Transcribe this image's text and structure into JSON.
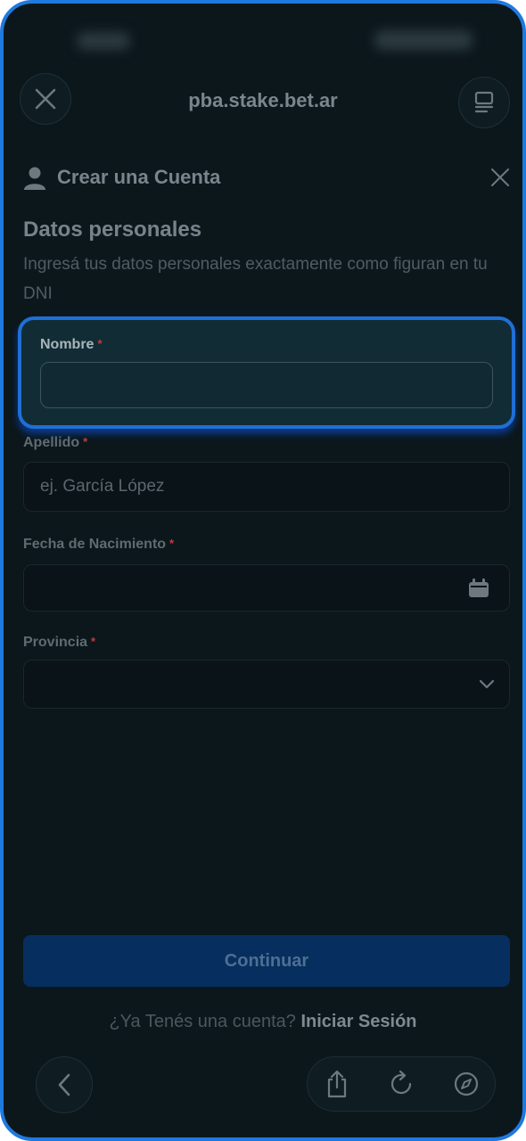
{
  "browser": {
    "url": "pba.stake.bet.ar",
    "close_icon": "close-icon",
    "tabs_icon": "tabs-icon",
    "back_icon": "chevron-left-icon",
    "share_icon": "share-icon",
    "reload_icon": "reload-icon",
    "compass_icon": "compass-icon"
  },
  "modal": {
    "title": "Crear una Cuenta",
    "user_icon": "user-icon",
    "close_icon": "close-icon"
  },
  "section": {
    "title": "Datos personales",
    "description": "Ingresá tus datos personales exactamente como figuran en tu DNI"
  },
  "form": {
    "nombre": {
      "label": "Nombre",
      "required_mark": "*",
      "value": "",
      "placeholder": ""
    },
    "apellido": {
      "label": "Apellido",
      "required_mark": "*",
      "value": "",
      "placeholder": "ej. García López"
    },
    "fecha": {
      "label": "Fecha de Nacimiento",
      "required_mark": "*",
      "value": "",
      "icon": "calendar-icon"
    },
    "provincia": {
      "label": "Provincia",
      "required_mark": "*",
      "value": "",
      "icon": "chevron-down-icon"
    }
  },
  "actions": {
    "continue_label": "Continuar",
    "login_prompt": "¿Ya Tenés una cuenta?",
    "login_link": "Iniciar Sesión"
  },
  "colors": {
    "accent": "#1f7ae0",
    "background": "#0c171c",
    "required": "#c23b3b"
  }
}
